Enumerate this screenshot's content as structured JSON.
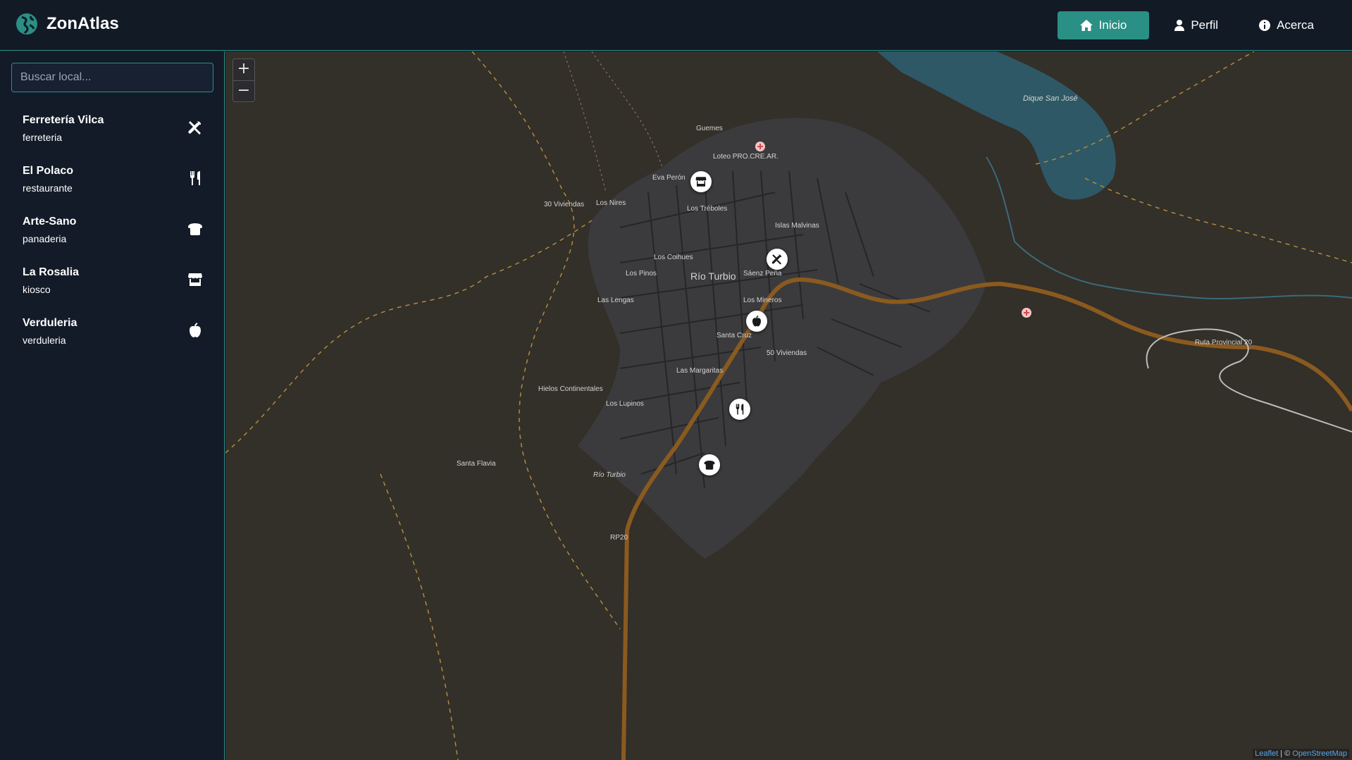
{
  "app": {
    "name": "ZonAtlas"
  },
  "nav": {
    "home_label": "Inicio",
    "profile_label": "Perfil",
    "about_label": "Acerca"
  },
  "search": {
    "placeholder": "Buscar local...",
    "value": ""
  },
  "places": [
    {
      "name": "Ferretería Vilca",
      "category": "ferreteria",
      "icon": "tools-icon"
    },
    {
      "name": "El Polaco",
      "category": "restaurante",
      "icon": "utensils-icon"
    },
    {
      "name": "Arte-Sano",
      "category": "panaderia",
      "icon": "bread-icon"
    },
    {
      "name": "La Rosalia",
      "category": "kiosco",
      "icon": "store-icon"
    },
    {
      "name": "Verduleria",
      "category": "verduleria",
      "icon": "apple-icon"
    }
  ],
  "map": {
    "zoom_in": "+",
    "zoom_out": "−",
    "attribution_leaflet": "Leaflet",
    "attribution_sep": " | © ",
    "attribution_osm": "OpenStreetMap",
    "labels": {
      "city": "Río Turbio",
      "dam": "Dique San José",
      "route": "Ruta Provincial 20",
      "rp20": "RP20",
      "saenz": "Sáenz Peña",
      "guemes": "Guemes",
      "loteo": "Loteo PRO.CRE.AR.",
      "eva": "Eva Perón",
      "viviendas30": "30 Viviendas",
      "nires": "Los Nires",
      "treboles": "Los Tréboles",
      "malvinas": "Islas Malvinas",
      "coihues": "Los Coihues",
      "pinos": "Los Pinos",
      "lengas": "Las Lengas",
      "mineros": "Los Mineros",
      "santacruz": "Santa Cruz",
      "viviendas50": "50 Viviendas",
      "margaritas": "Las Margaritas",
      "hielos": "Hielos Continentales",
      "lupinos": "Los Lupinos",
      "flavia": "Santa Flavia",
      "rioturbio_river": "Río Turbio"
    }
  },
  "colors": {
    "accent": "#2a8f85",
    "topbar_bg": "#121a26",
    "sidebar_bg": "#131b28",
    "map_bg": "#332f29",
    "road_main": "#8a5a1f",
    "water": "#2e5866"
  }
}
